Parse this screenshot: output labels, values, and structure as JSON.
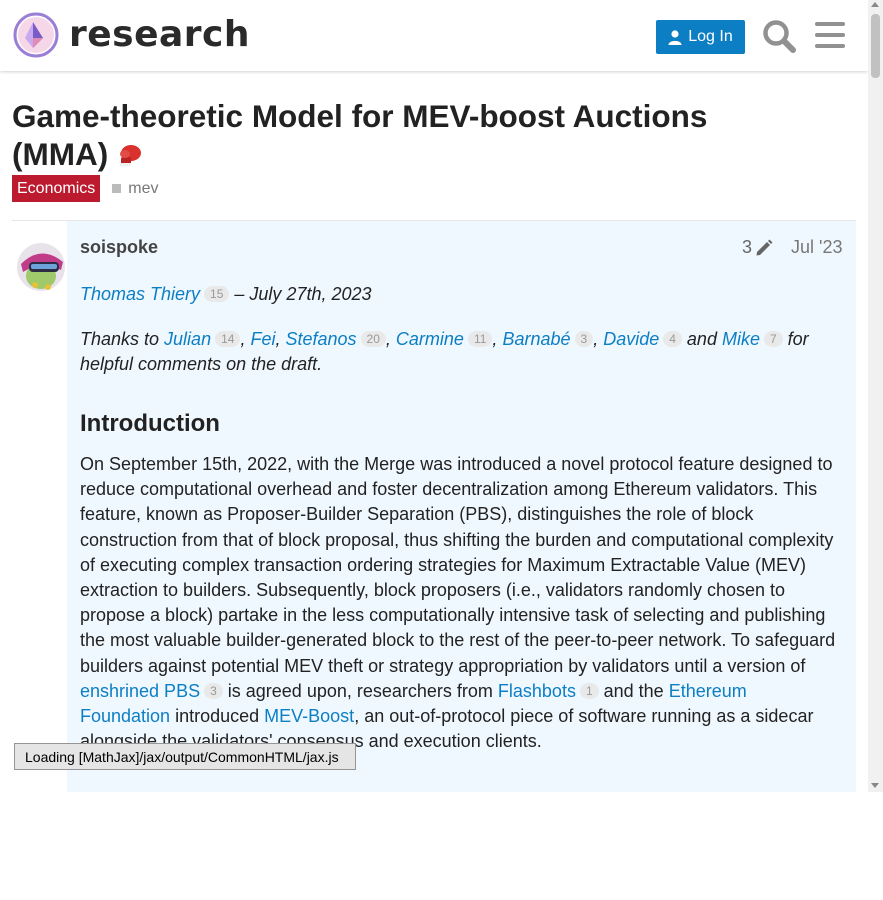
{
  "header": {
    "site_name": "research",
    "login_label": "Log In",
    "icons": [
      "ethereum-research-logo-icon",
      "user-icon",
      "search-icon",
      "hamburger-menu-icon"
    ]
  },
  "topic": {
    "title": "Game-theoretic Model for MEV-boost Auctions (MMA)",
    "category": "Economics",
    "category_color": "#bc1b2f",
    "tag": "mev"
  },
  "post": {
    "username": "soispoke",
    "edit_count": "3",
    "date": "Jul '23",
    "author_line": {
      "author": "Thomas Thiery",
      "author_count": "15",
      "date_text": " – July 27th, 2023"
    },
    "thanks": {
      "prefix": "Thanks to ",
      "people": [
        {
          "name": "Julian",
          "count": "14"
        },
        {
          "name": "Fei",
          "count": ""
        },
        {
          "name": "Stefanos",
          "count": "20"
        },
        {
          "name": "Carmine",
          "count": "11"
        },
        {
          "name": "Barnabé",
          "count": "3"
        },
        {
          "name": "Davide",
          "count": "4"
        },
        {
          "name": "Mike",
          "count": "7"
        }
      ],
      "and": " and ",
      "suffix": " for helpful comments on the draft."
    },
    "heading": "Introduction",
    "intro_text": "On September 15th, 2022, with the Merge was introduced a novel protocol feature designed to reduce computational overhead and foster decentralization among Ethereum validators. This feature, known as Proposer-Builder Separation (PBS), distinguishes the role of block construction from that of block proposal, thus shifting the burden and computational complexity of executing complex transaction ordering strategies for Maximum Extractable Value (MEV) extraction to builders. Subsequently, block proposers (i.e., validators randomly chosen to propose a block) partake in the less computationally intensive task of selecting and publishing the most valuable builder-generated block to the rest of the peer-to-peer network. To safeguard builders against potential MEV theft or strategy appropriation by validators until a version of ",
    "link_epbs": "enshrined PBS",
    "link_epbs_count": "3",
    "text_2": " is agreed upon, researchers from ",
    "link_flashbots": "Flashbots",
    "link_flashbots_count": "1",
    "text_3": " and the ",
    "link_ef": "Ethereum Foundation",
    "text_4": " introduced ",
    "link_mevboost": "MEV-Boost",
    "text_5": ", an out-of-protocol piece of software running as a sidecar alongside the validators' consensus and execution clients."
  },
  "status": {
    "loading_text": "Loading [MathJax]/jax/output/CommonHTML/jax.js"
  }
}
